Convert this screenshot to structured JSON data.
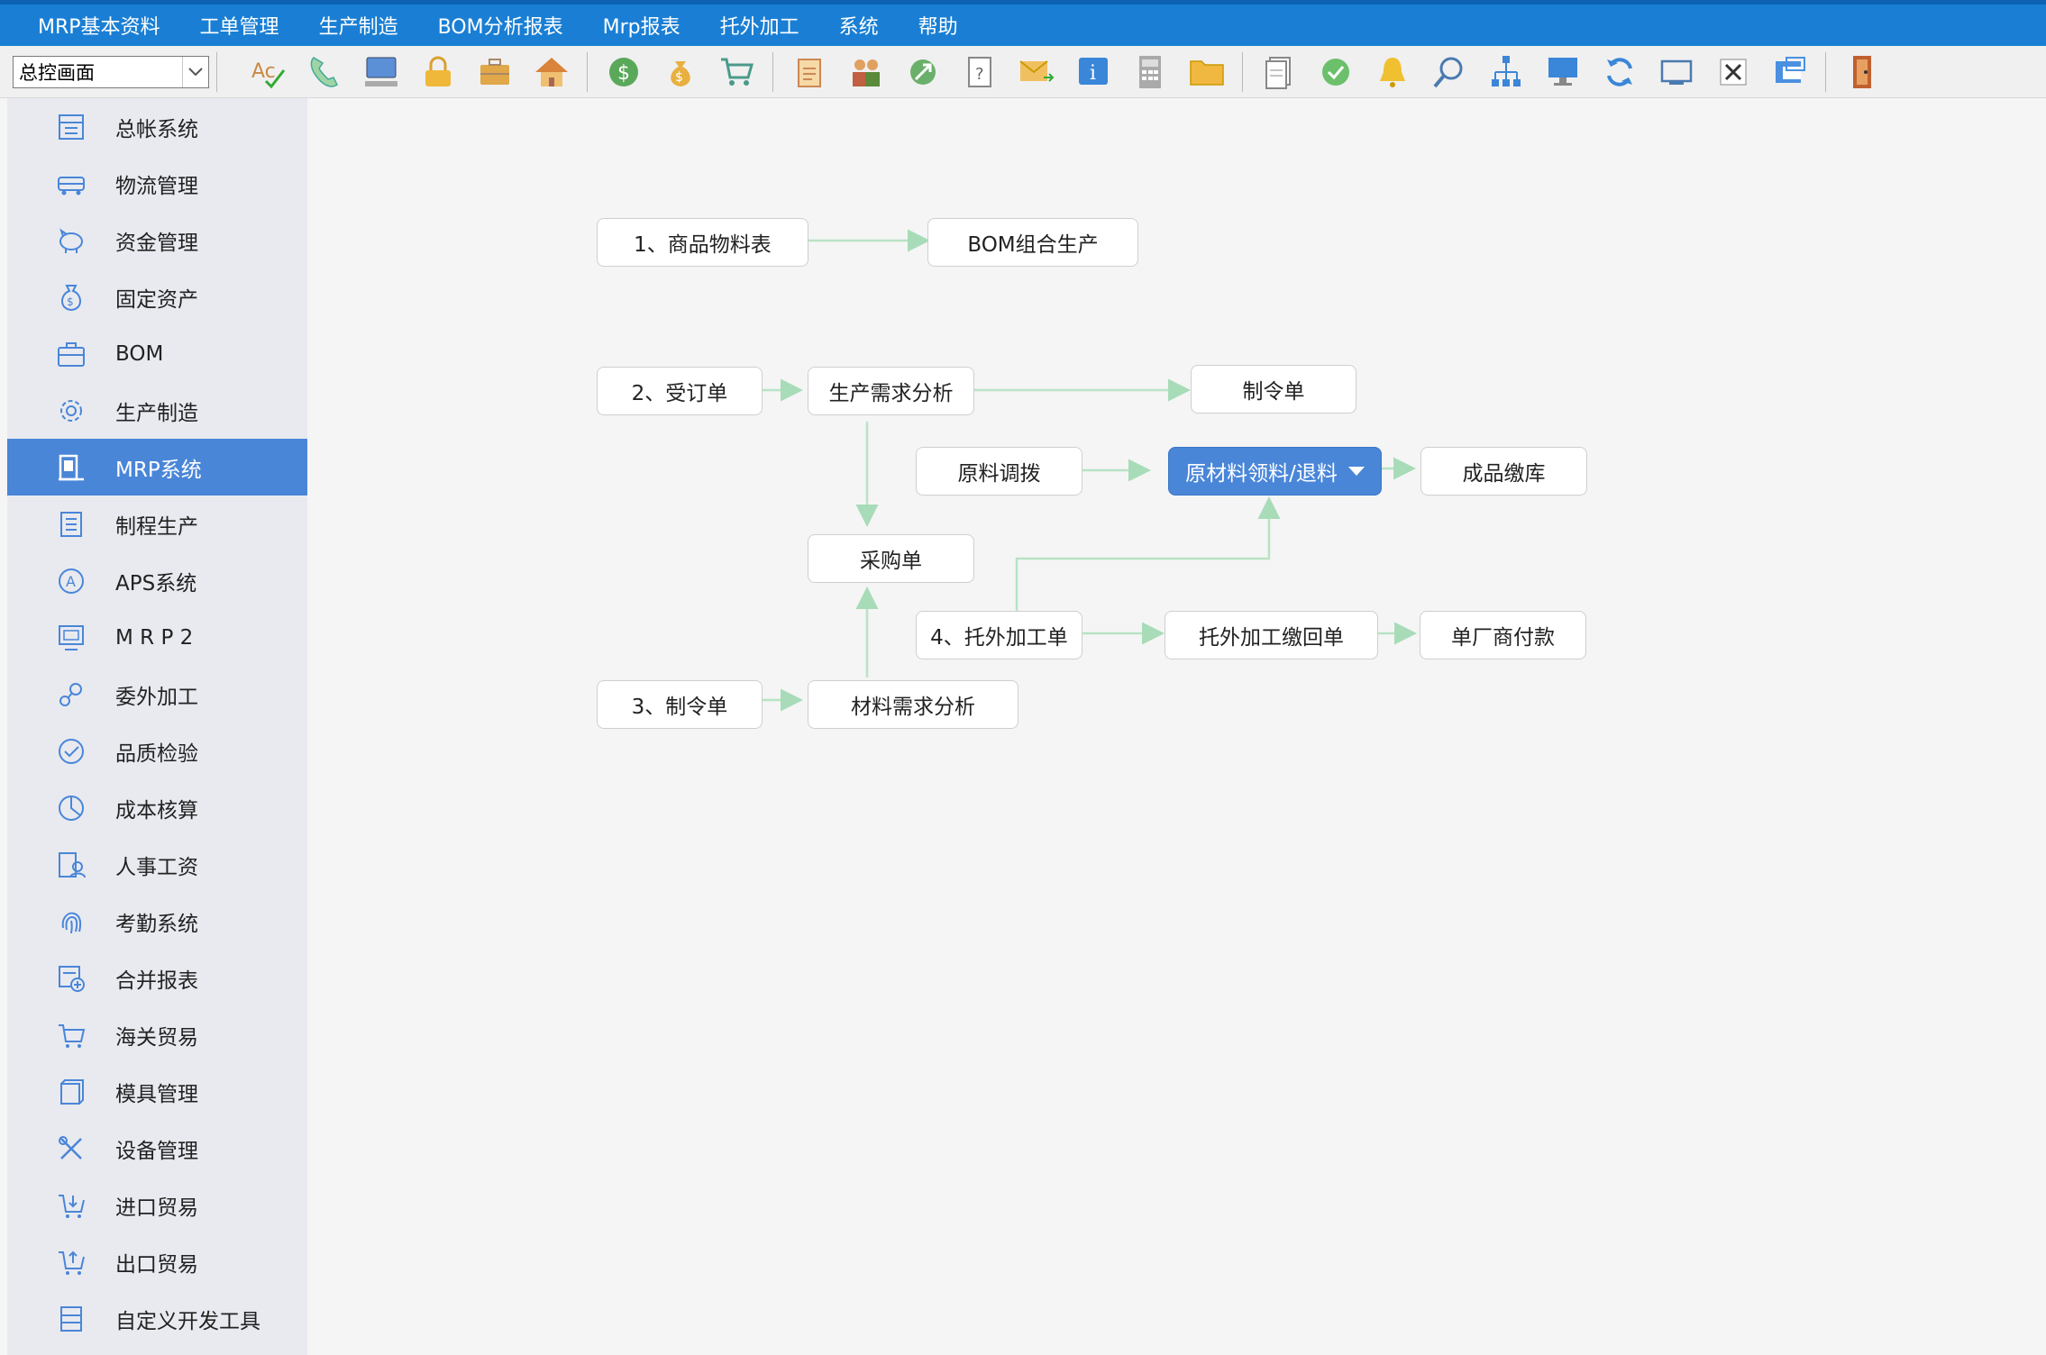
{
  "menu": [
    "MRP基本资料",
    "工单管理",
    "生产制造",
    "BOM分析报表",
    "Mrp报表",
    "托外加工",
    "系统",
    "帮助"
  ],
  "toolbar": {
    "combo_value": "总控画面",
    "icons": [
      "spellcheck-icon",
      "phone-icon",
      "computer-icon",
      "lock-icon",
      "briefcase-icon",
      "home-icon",
      "dollar-icon",
      "money-bag-icon",
      "cart-icon",
      "clipboard-icon",
      "users-icon",
      "link-icon",
      "help-doc-icon",
      "mail-icon",
      "info-icon",
      "calculator-icon",
      "folder-icon",
      "document-icon",
      "check-icon",
      "bell-icon",
      "search-icon",
      "org-chart-icon",
      "monitor-icon",
      "refresh-icon",
      "window-icon",
      "close-icon",
      "restore-icon",
      "exit-door-icon"
    ]
  },
  "sidebar": [
    {
      "label": "总帐系统",
      "icon": "ledger-icon"
    },
    {
      "label": "物流管理",
      "icon": "truck-icon"
    },
    {
      "label": "资金管理",
      "icon": "piggy-bank-icon"
    },
    {
      "label": "固定资产",
      "icon": "asset-bag-icon"
    },
    {
      "label": "BOM",
      "icon": "briefcase-icon"
    },
    {
      "label": "生产制造",
      "icon": "gear-icon"
    },
    {
      "label": "MRP系统",
      "icon": "building-icon",
      "active": true
    },
    {
      "label": "制程生产",
      "icon": "list-doc-icon"
    },
    {
      "label": "APS系统",
      "icon": "circle-a-icon"
    },
    {
      "label": "M R P 2",
      "icon": "monitor-icon"
    },
    {
      "label": "委外加工",
      "icon": "gears-icon"
    },
    {
      "label": "品质检验",
      "icon": "check-circle-icon"
    },
    {
      "label": "成本核算",
      "icon": "pie-clock-icon"
    },
    {
      "label": "人事工资",
      "icon": "person-doc-icon"
    },
    {
      "label": "考勤系统",
      "icon": "fingerprint-icon"
    },
    {
      "label": "合并报表",
      "icon": "report-plus-icon"
    },
    {
      "label": "海关贸易",
      "icon": "cart-icon"
    },
    {
      "label": "模具管理",
      "icon": "mold-icon"
    },
    {
      "label": "设备管理",
      "icon": "tools-icon"
    },
    {
      "label": "进口贸易",
      "icon": "cart-in-icon"
    },
    {
      "label": "出口贸易",
      "icon": "cart-out-icon"
    },
    {
      "label": "自定义开发工具",
      "icon": "table-icon"
    }
  ],
  "flow": {
    "n1": "1、商品物料表",
    "n2": "BOM组合生产",
    "n3": "2、受订单",
    "n4": "生产需求分析",
    "n5": "制令单",
    "n6": "原料调拨",
    "n7": "原材料领料/退料",
    "n8": "成品缴库",
    "n9": "采购单",
    "n10": "4、托外加工单",
    "n11": "托外加工缴回单",
    "n12": "单厂商付款",
    "n13": "3、制令单",
    "n14": "材料需求分析"
  },
  "colors": {
    "menubar": "#1a7fd4",
    "active": "#4a86d8",
    "connector": "#b8e3c4"
  }
}
